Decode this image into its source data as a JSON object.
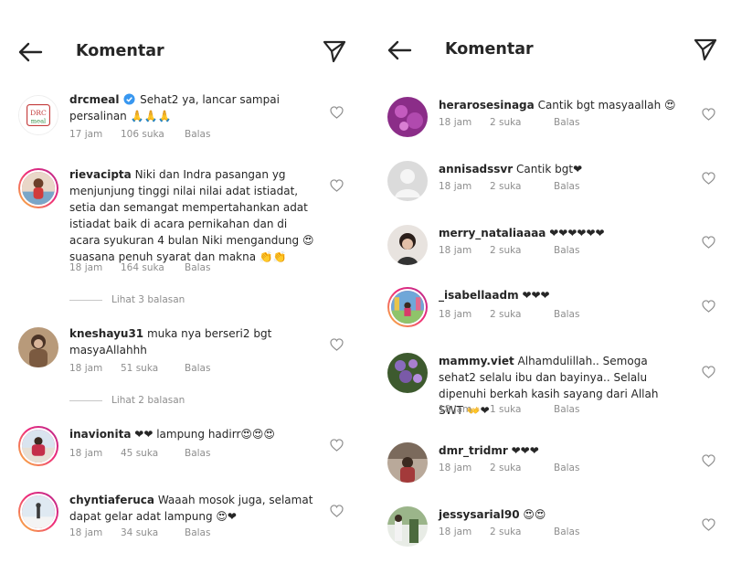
{
  "left": {
    "header": {
      "title": "Komentar"
    },
    "comments": [
      {
        "username": "drcmeal",
        "verified": true,
        "text": "Sehat2 ya, lancar sampai persalinan 🙏🙏🙏",
        "time": "17 jam",
        "likes": "106 suka",
        "reply": "Balas",
        "avatar_text": "DRC meal"
      },
      {
        "username": "rievacipta",
        "text": "Niki dan Indra pasangan yg menjunjung tinggi nilai nilai adat istiadat, setia dan semangat mempertahankan adat istiadat baik di acara pernikahan dan di acara syukuran 4 bulan Niki mengandung 😍 suasana penuh syarat dan makna 👏👏",
        "time": "18 jam",
        "likes": "164 suka",
        "reply": "Balas",
        "view_replies": "Lihat 3 balasan"
      },
      {
        "username": "kneshayu31",
        "text": "muka nya berseri2 bgt masyaAllahhh",
        "time": "18 jam",
        "likes": "51 suka",
        "reply": "Balas",
        "view_replies": "Lihat 2 balasan"
      },
      {
        "username": "inavionita",
        "text": "❤❤ lampung hadirr😍😍😍",
        "time": "18 jam",
        "likes": "45 suka",
        "reply": "Balas"
      },
      {
        "username": "chyntiaferuca",
        "text": "Waaah mosok juga, selamat dapat gelar adat lampung 😍❤",
        "time": "18 jam",
        "likes": "34 suka",
        "reply": "Balas"
      }
    ]
  },
  "right": {
    "header": {
      "title": "Komentar"
    },
    "comments": [
      {
        "username": "herarosesinaga",
        "text": "Cantik bgt masyaallah 😍",
        "time": "18 jam",
        "likes": "2 suka",
        "reply": "Balas"
      },
      {
        "username": "annisadssvr",
        "text": "Cantik bgt❤",
        "time": "18 jam",
        "likes": "2 suka",
        "reply": "Balas"
      },
      {
        "username": "merry_nataliaaaa",
        "text": "❤❤❤❤❤❤",
        "time": "18 jam",
        "likes": "2 suka",
        "reply": "Balas"
      },
      {
        "username": "_isabellaadm",
        "text": "❤❤❤",
        "time": "18 jam",
        "likes": "2 suka",
        "reply": "Balas"
      },
      {
        "username": "mammy.viet",
        "text": "Alhamdulillah.. Semoga sehat2 selalu ibu dan bayinya.. Selalu dipenuhi berkah kasih sayang dari Allah SWT 👐❤",
        "time": "18 jam",
        "likes": "1 suka",
        "reply": "Balas"
      },
      {
        "username": "dmr_tridmr",
        "text": "❤❤❤",
        "time": "18 jam",
        "likes": "2 suka",
        "reply": "Balas"
      },
      {
        "username": "jessysarial90",
        "text": "😍😍",
        "time": "18 jam",
        "likes": "2 suka",
        "reply": "Balas"
      }
    ]
  },
  "icons": {
    "back": "arrow-left-icon",
    "send": "paper-plane-icon",
    "heart": "heart-outline-icon",
    "verified": "verified-badge-icon"
  },
  "colors": {
    "text": "#262626",
    "muted": "#8e8e8e",
    "verified": "#3897f0",
    "story_ring_start": "#f9c33a",
    "story_ring_end": "#b52a8c"
  }
}
